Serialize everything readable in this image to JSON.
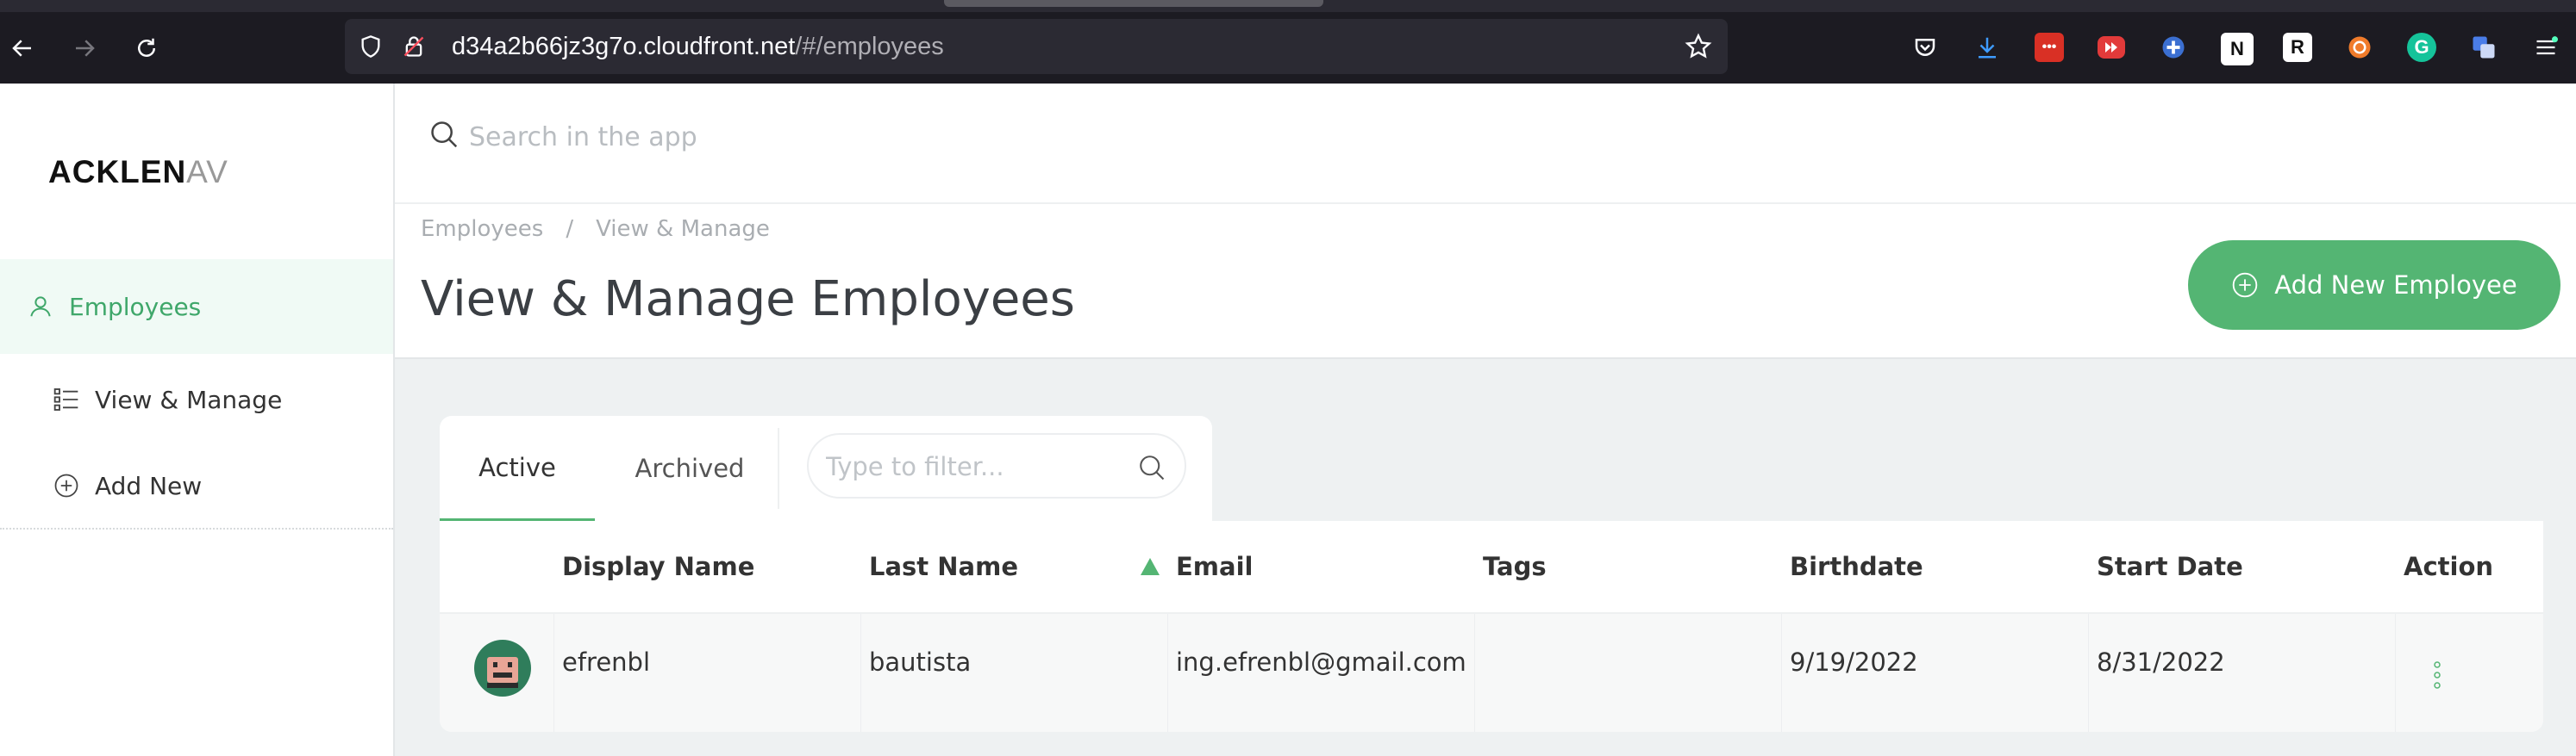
{
  "browser": {
    "url_host": "d34a2b66jz3g7o.cloudfront.net",
    "url_path": "/#/employees",
    "extensions": [
      {
        "name": "pocket-icon"
      },
      {
        "name": "download-icon",
        "color": "#3e9bff"
      },
      {
        "name": "more-dots-extension-icon",
        "color": "#d93025"
      },
      {
        "name": "video-speed-icon",
        "color": "#e23a3a"
      },
      {
        "name": "puzzle-extension-icon",
        "color": "#3b6fd1"
      },
      {
        "name": "notion-icon",
        "label": "N"
      },
      {
        "name": "r-extension-icon",
        "label": "R"
      },
      {
        "name": "orange-circle-extension-icon",
        "color": "#f07b2a"
      },
      {
        "name": "grammarly-icon",
        "label": "G",
        "color": "#15c39a"
      },
      {
        "name": "translate-icon",
        "color": "#4a7de8"
      },
      {
        "name": "menu-icon"
      }
    ]
  },
  "logo": {
    "main": "ACKLEN",
    "fade": "AV"
  },
  "sidebar": {
    "items": [
      {
        "label": "Employees",
        "icon": "user-icon",
        "active": true
      },
      {
        "label": "View & Manage",
        "icon": "list-icon"
      },
      {
        "label": "Add New",
        "icon": "plus-circle-icon"
      }
    ]
  },
  "search": {
    "placeholder": "Search in the app"
  },
  "breadcrumb": {
    "items": [
      "Employees",
      "View & Manage"
    ],
    "separator": "/"
  },
  "page": {
    "title": "View & Manage Employees"
  },
  "add_button": {
    "label": "Add New Employee"
  },
  "tabs": [
    {
      "label": "Active",
      "active": true
    },
    {
      "label": "Archived"
    }
  ],
  "filter": {
    "placeholder": "Type to filter..."
  },
  "table": {
    "columns": [
      "Display Name",
      "Last Name",
      "Email",
      "Tags",
      "Birthdate",
      "Start Date",
      "Action"
    ],
    "sorted_column": "Email",
    "rows": [
      {
        "display_name": "efrenbl",
        "last_name": "bautista",
        "email": "ing.efrenbl@gmail.com",
        "tags": "",
        "birthdate": "9/19/2022",
        "start_date": "8/31/2022"
      }
    ]
  },
  "colors": {
    "accent": "#54b573",
    "accent_text": "#3fa76a"
  }
}
